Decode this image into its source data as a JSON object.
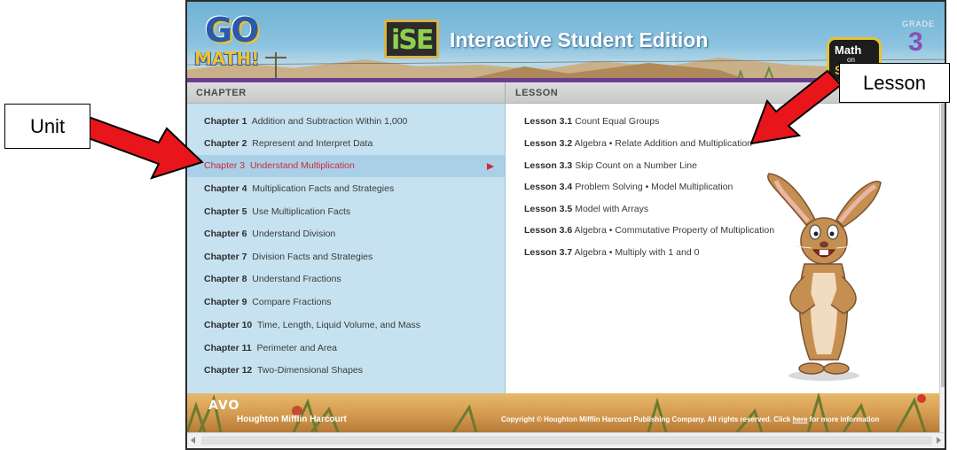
{
  "header": {
    "logo_go": "GO",
    "logo_math": "MATH!",
    "badge": "iSE",
    "title": "Interactive Student Edition",
    "grade_label": "GRADE",
    "grade_number": "3",
    "mos_line1": "Math",
    "mos_line2": "on",
    "mos_line3": "Sp"
  },
  "columns": {
    "chapter": "CHAPTER",
    "lesson": "LESSON"
  },
  "chapters": [
    {
      "num": "Chapter 1",
      "title": "Addition and Subtraction Within 1,000",
      "selected": false
    },
    {
      "num": "Chapter 2",
      "title": "Represent and Interpret Data",
      "selected": false
    },
    {
      "num": "Chapter 3",
      "title": "Understand Multiplication",
      "selected": true
    },
    {
      "num": "Chapter 4",
      "title": "Multiplication Facts and Strategies",
      "selected": false
    },
    {
      "num": "Chapter 5",
      "title": "Use Multiplication Facts",
      "selected": false
    },
    {
      "num": "Chapter 6",
      "title": "Understand Division",
      "selected": false
    },
    {
      "num": "Chapter 7",
      "title": "Division Facts and Strategies",
      "selected": false
    },
    {
      "num": "Chapter 8",
      "title": "Understand Fractions",
      "selected": false
    },
    {
      "num": "Chapter 9",
      "title": "Compare Fractions",
      "selected": false
    },
    {
      "num": "Chapter 10",
      "title": "Time, Length, Liquid Volume, and Mass",
      "selected": false
    },
    {
      "num": "Chapter 11",
      "title": "Perimeter and Area",
      "selected": false
    },
    {
      "num": "Chapter 12",
      "title": "Two-Dimensional Shapes",
      "selected": false
    }
  ],
  "lessons": [
    {
      "num": "Lesson 3.1",
      "title": "Count Equal Groups"
    },
    {
      "num": "Lesson 3.2",
      "title": "Algebra • Relate Addition and Multiplication"
    },
    {
      "num": "Lesson 3.3",
      "title": "Skip Count on a Number Line"
    },
    {
      "num": "Lesson 3.4",
      "title": "Problem Solving • Model Multiplication"
    },
    {
      "num": "Lesson 3.5",
      "title": "Model with Arrays"
    },
    {
      "num": "Lesson 3.6",
      "title": "Algebra • Commutative Property of Multiplication"
    },
    {
      "num": "Lesson 3.7",
      "title": "Algebra • Multiply with 1 and 0"
    }
  ],
  "footer": {
    "logo": "AVO",
    "publisher": "Houghton Mifflin Harcourt",
    "copyright_prefix": "Copyright © Houghton Mifflin Harcourt Publishing Company. All rights reserved. Click ",
    "copyright_link": "here",
    "copyright_suffix": " for more information"
  },
  "annotations": {
    "unit": "Unit",
    "lesson": "Lesson"
  },
  "colors": {
    "chapter_panel_bg": "#c6e2f1",
    "selected_text": "#d0283b",
    "arrow_red": "#e8151b"
  }
}
